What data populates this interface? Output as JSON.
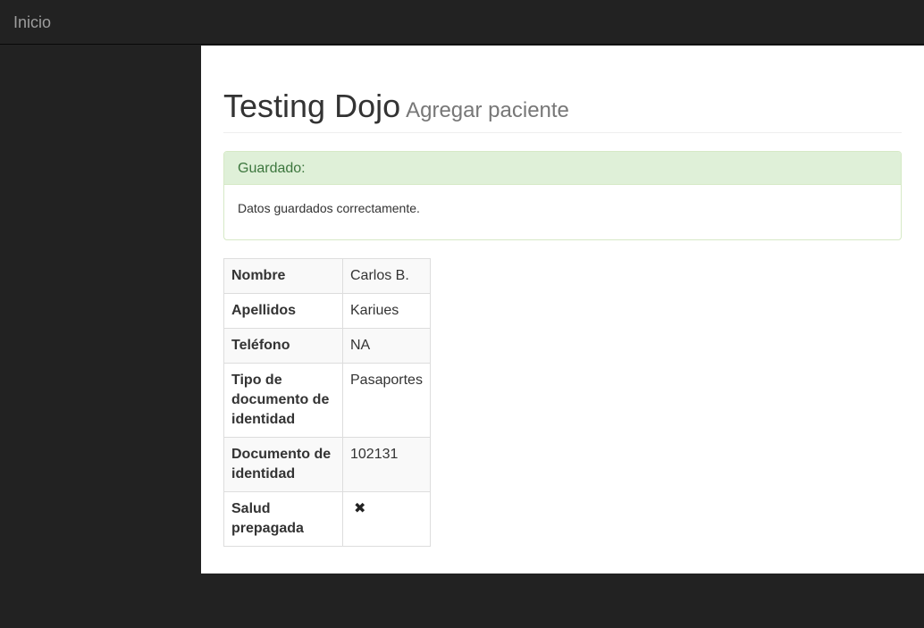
{
  "navbar": {
    "brand": "Inicio"
  },
  "header": {
    "title": "Testing Dojo",
    "subtitle": "Agregar paciente"
  },
  "alert": {
    "heading": "Guardado:",
    "message": "Datos guardados correctamente."
  },
  "details": {
    "rows": [
      {
        "label": "Nombre",
        "value": "Carlos B."
      },
      {
        "label": "Apellidos",
        "value": "Kariues"
      },
      {
        "label": "Teléfono",
        "value": "NA"
      },
      {
        "label": "Tipo de documento de identidad",
        "value": "Pasaportes"
      },
      {
        "label": "Documento de identidad",
        "value": "102131"
      },
      {
        "label": "Salud prepagada",
        "value_icon": "x-icon",
        "value_glyph": "✖"
      }
    ]
  },
  "colors": {
    "navbar_bg": "#222222",
    "brand_text": "#9d9d9d",
    "success_bg": "#dff0d8",
    "success_text": "#3c763d",
    "success_border": "#d6e9c6"
  }
}
